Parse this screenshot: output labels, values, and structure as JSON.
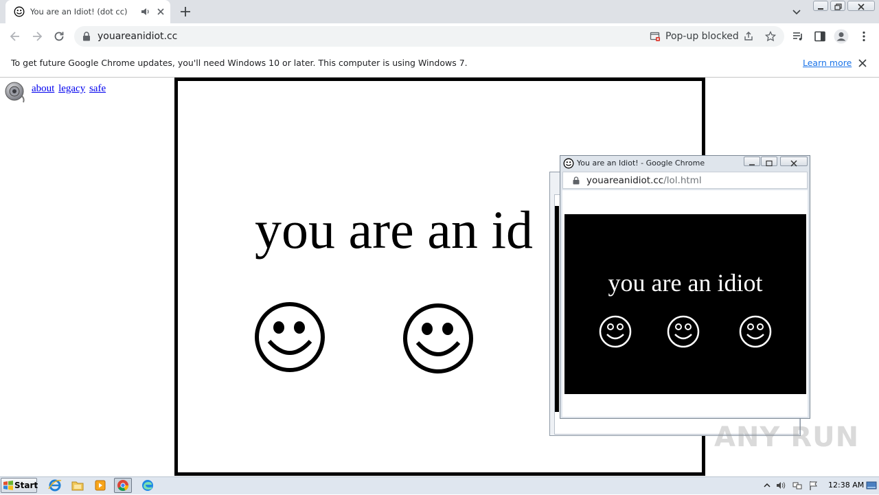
{
  "browser": {
    "tab": {
      "title": "You are an Idiot! (dot cc)"
    },
    "address": {
      "url": "youareanidiot.cc"
    },
    "popup_status": "Pop-up blocked"
  },
  "infobar": {
    "message": "To get future Google Chrome updates, you'll need Windows 10 or later. This computer is using Windows 7.",
    "learn_more": "Learn more"
  },
  "page": {
    "links": [
      "about",
      "legacy",
      "safe"
    ],
    "headline": "you are an id"
  },
  "popup": {
    "title": "You are an Idiot! - Google Chrome",
    "url_host": "youareanidiot.cc",
    "url_path": "/lol.html",
    "headline": "you are an idiot"
  },
  "watermark": "ANY RUN",
  "taskbar": {
    "start_label": "Start",
    "clock": "12:38 AM"
  }
}
